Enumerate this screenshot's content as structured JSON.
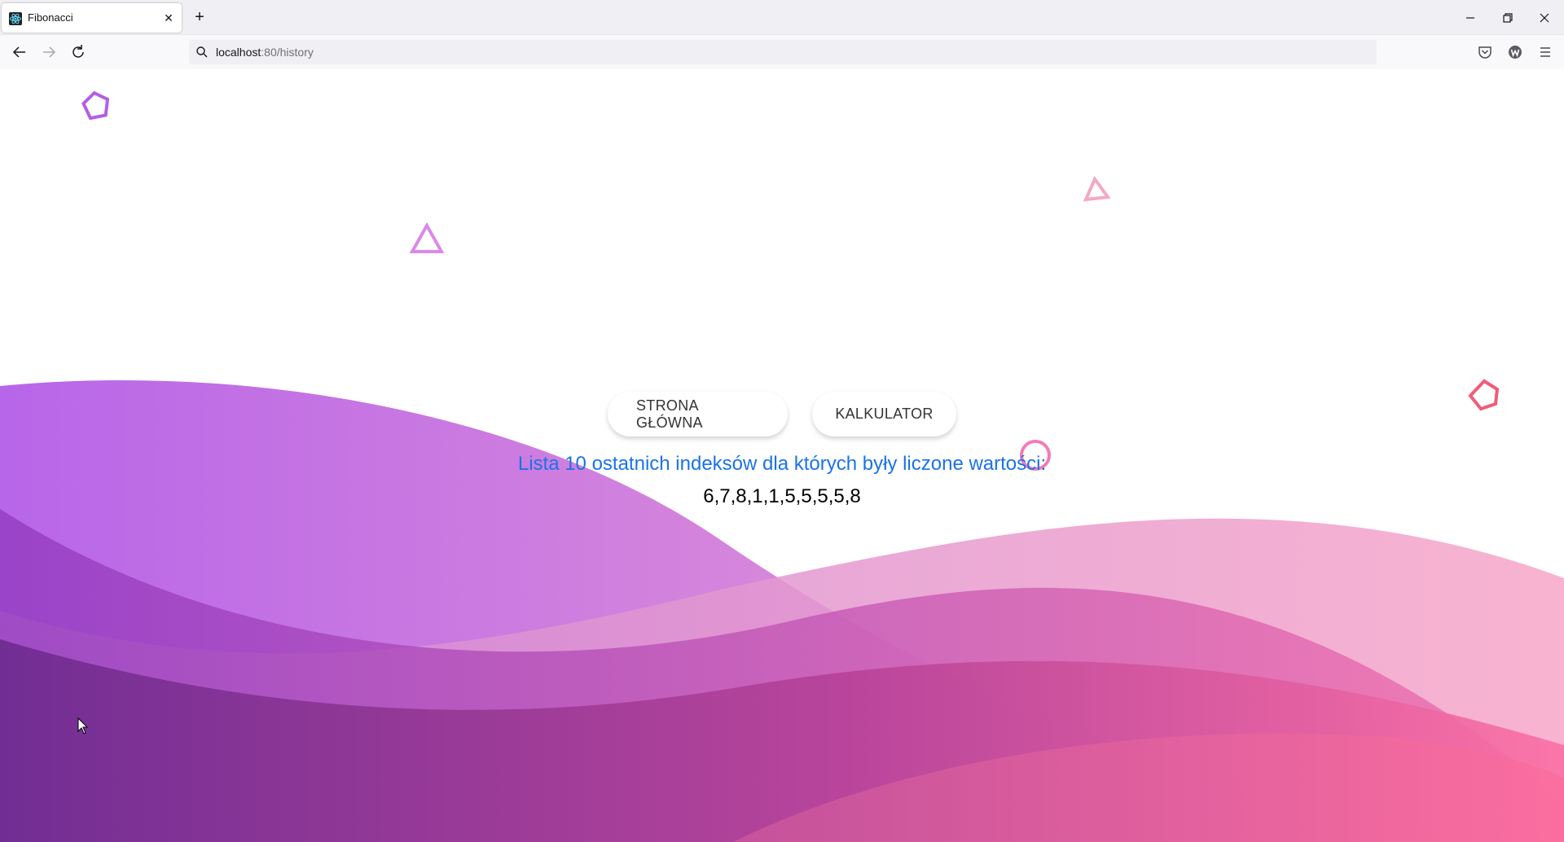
{
  "browser": {
    "tab": {
      "title": "Fibonacci",
      "close_glyph": "✕",
      "favicon": "react-icon"
    },
    "new_tab_glyph": "+",
    "window_controls": {
      "minimize_glyph": "—",
      "restore_glyph": "❐",
      "close_glyph": "✕"
    },
    "nav": {
      "back": "back-arrow-icon",
      "forward": "forward-arrow-icon",
      "reload": "reload-icon"
    },
    "url": {
      "host": "localhost",
      "rest": ":80/history"
    },
    "toolbar_icons": [
      "pocket-icon",
      "account-icon",
      "menu-icon"
    ]
  },
  "page": {
    "buttons": {
      "home_label": "STRONA GŁÓWNA",
      "calculator_label": "KALKULATOR"
    },
    "history": {
      "title": "Lista 10 ostatnich indeksów dla których były liczone wartości:",
      "values": "6,7,8,1,1,5,5,5,5,8"
    }
  },
  "colors": {
    "link_blue": "#1a73e8",
    "purple": "#b45ee8",
    "pink": "#f47cac"
  }
}
